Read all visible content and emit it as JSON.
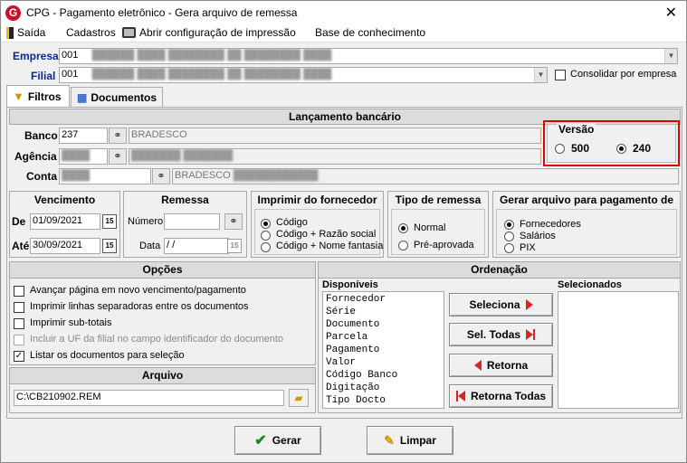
{
  "window": {
    "title": "CPG - Pagamento eletrônico - Gera arquivo de remessa",
    "icon": "app-logo-icon"
  },
  "menu": {
    "items": [
      "Saída",
      "Cadastros",
      "Abrir configuração de impressão",
      "Base de conhecimento"
    ]
  },
  "header": {
    "empresa_label": "Empresa",
    "empresa_value": "001",
    "filial_label": "Filial",
    "filial_value": "001",
    "consolidar_label": "Consolidar por empresa"
  },
  "tabs": [
    "Filtros",
    "Documentos"
  ],
  "lancamento": {
    "title": "Lançamento bancário",
    "banco_label": "Banco",
    "banco_code": "237",
    "banco_name": "BRADESCO",
    "agencia_label": "Agência",
    "conta_label": "Conta",
    "conta_bank_name": "BRADESCO"
  },
  "versao": {
    "title": "Versão",
    "options": [
      "500",
      "240"
    ],
    "selected": "240"
  },
  "vencimento": {
    "title": "Vencimento",
    "de_label": "De",
    "de_value": "01/09/2021",
    "ate_label": "Até",
    "ate_value": "30/09/2021"
  },
  "remessa": {
    "title": "Remessa",
    "numero_label": "Número",
    "numero_value": "",
    "data_label": "Data",
    "data_value": " /  /"
  },
  "imprimir": {
    "title": "Imprimir do fornecedor",
    "options": [
      "Código",
      "Código + Razão social",
      "Código + Nome fantasia"
    ],
    "selected": "Código"
  },
  "tipo_remessa": {
    "title": "Tipo de remessa",
    "options": [
      "Normal",
      "Pré-aprovada"
    ],
    "selected": "Normal"
  },
  "gerar_arquivo": {
    "title": "Gerar arquivo para pagamento de",
    "options": [
      "Fornecedores",
      "Salários",
      "PIX"
    ],
    "selected": "Fornecedores"
  },
  "opcoes": {
    "title": "Opções",
    "items": [
      {
        "label": "Avançar página em novo vencimento/pagamento",
        "checked": false,
        "enabled": true
      },
      {
        "label": "Imprimir linhas separadoras entre os documentos",
        "checked": false,
        "enabled": true
      },
      {
        "label": "Imprimir sub-totais",
        "checked": false,
        "enabled": true
      },
      {
        "label": "Incluir a UF da filial no campo identificador do documento",
        "checked": false,
        "enabled": false
      },
      {
        "label": "Listar os documentos para seleção",
        "checked": true,
        "enabled": true
      }
    ]
  },
  "arquivo": {
    "title": "Arquivo",
    "value": "C:\\CB210902.REM"
  },
  "ordenacao": {
    "title": "Ordenação",
    "disponiveis_label": "Disponíveis",
    "disponiveis": [
      "Fornecedor",
      "Série",
      "Documento",
      "Parcela",
      "Pagamento",
      "Valor",
      "Código Banco",
      "Digitação",
      "Tipo Docto"
    ],
    "selecionados_label": "Selecionados",
    "buttons": [
      "Seleciona",
      "Sel. Todas",
      "Retorna",
      "Retorna Todas"
    ]
  },
  "footer": {
    "gerar_label": "Gerar",
    "limpar_label": "Limpar"
  },
  "colors": {
    "highlight_border": "#e00000",
    "header_label_blue": "#0a2a8a"
  }
}
